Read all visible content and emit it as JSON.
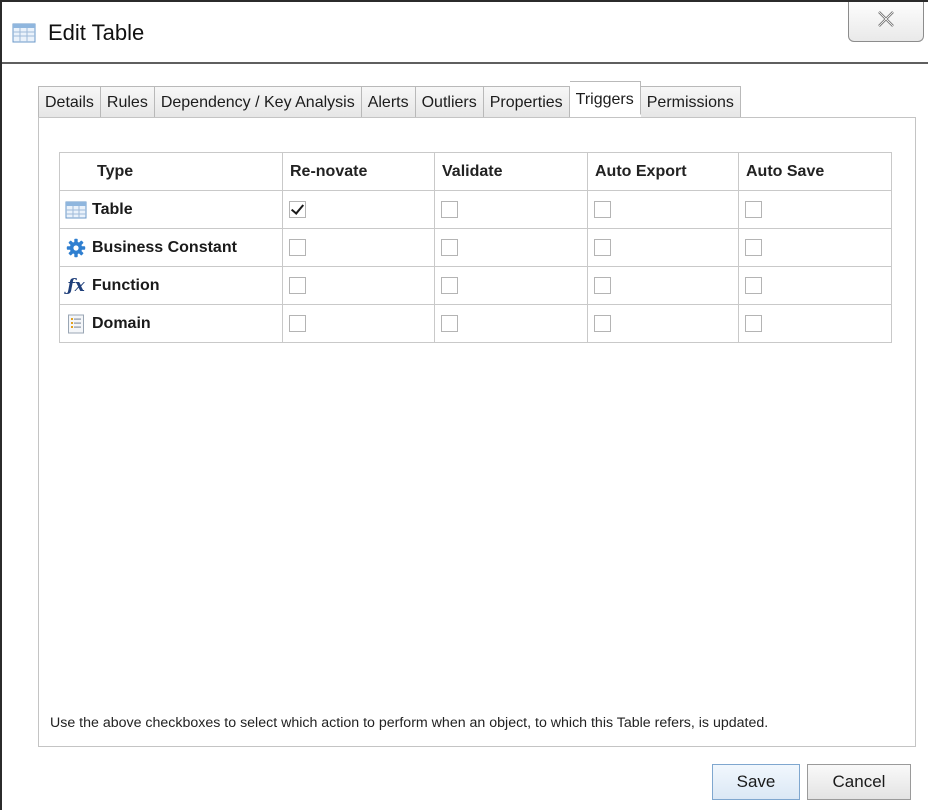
{
  "window": {
    "title": "Edit Table",
    "title_icon": "table-icon",
    "close_icon": "close-icon"
  },
  "tabs": [
    {
      "label": "Details",
      "active": false
    },
    {
      "label": "Rules",
      "active": false
    },
    {
      "label": "Dependency / Key Analysis",
      "active": false
    },
    {
      "label": "Alerts",
      "active": false
    },
    {
      "label": "Outliers",
      "active": false
    },
    {
      "label": "Properties",
      "active": false
    },
    {
      "label": "Triggers",
      "active": true
    },
    {
      "label": "Permissions",
      "active": false
    }
  ],
  "grid": {
    "columns": [
      "Type",
      "Re-novate",
      "Validate",
      "Auto Export",
      "Auto Save"
    ],
    "rows": [
      {
        "type": "Table",
        "icon": "table-icon",
        "renovate": true,
        "validate": false,
        "auto_export": false,
        "auto_save": false
      },
      {
        "type": "Business Constant",
        "icon": "gear-icon",
        "renovate": false,
        "validate": false,
        "auto_export": false,
        "auto_save": false
      },
      {
        "type": "Function",
        "icon": "function-fx-icon",
        "renovate": false,
        "validate": false,
        "auto_export": false,
        "auto_save": false
      },
      {
        "type": "Domain",
        "icon": "domain-list-icon",
        "renovate": false,
        "validate": false,
        "auto_export": false,
        "auto_save": false
      }
    ]
  },
  "hint": "Use the above checkboxes to select which action to perform when an object, to which this Table refers, is updated.",
  "buttons": {
    "save": "Save",
    "cancel": "Cancel"
  },
  "colors": {
    "accent": "#3a7ecf",
    "border": "#c9c9c9"
  }
}
